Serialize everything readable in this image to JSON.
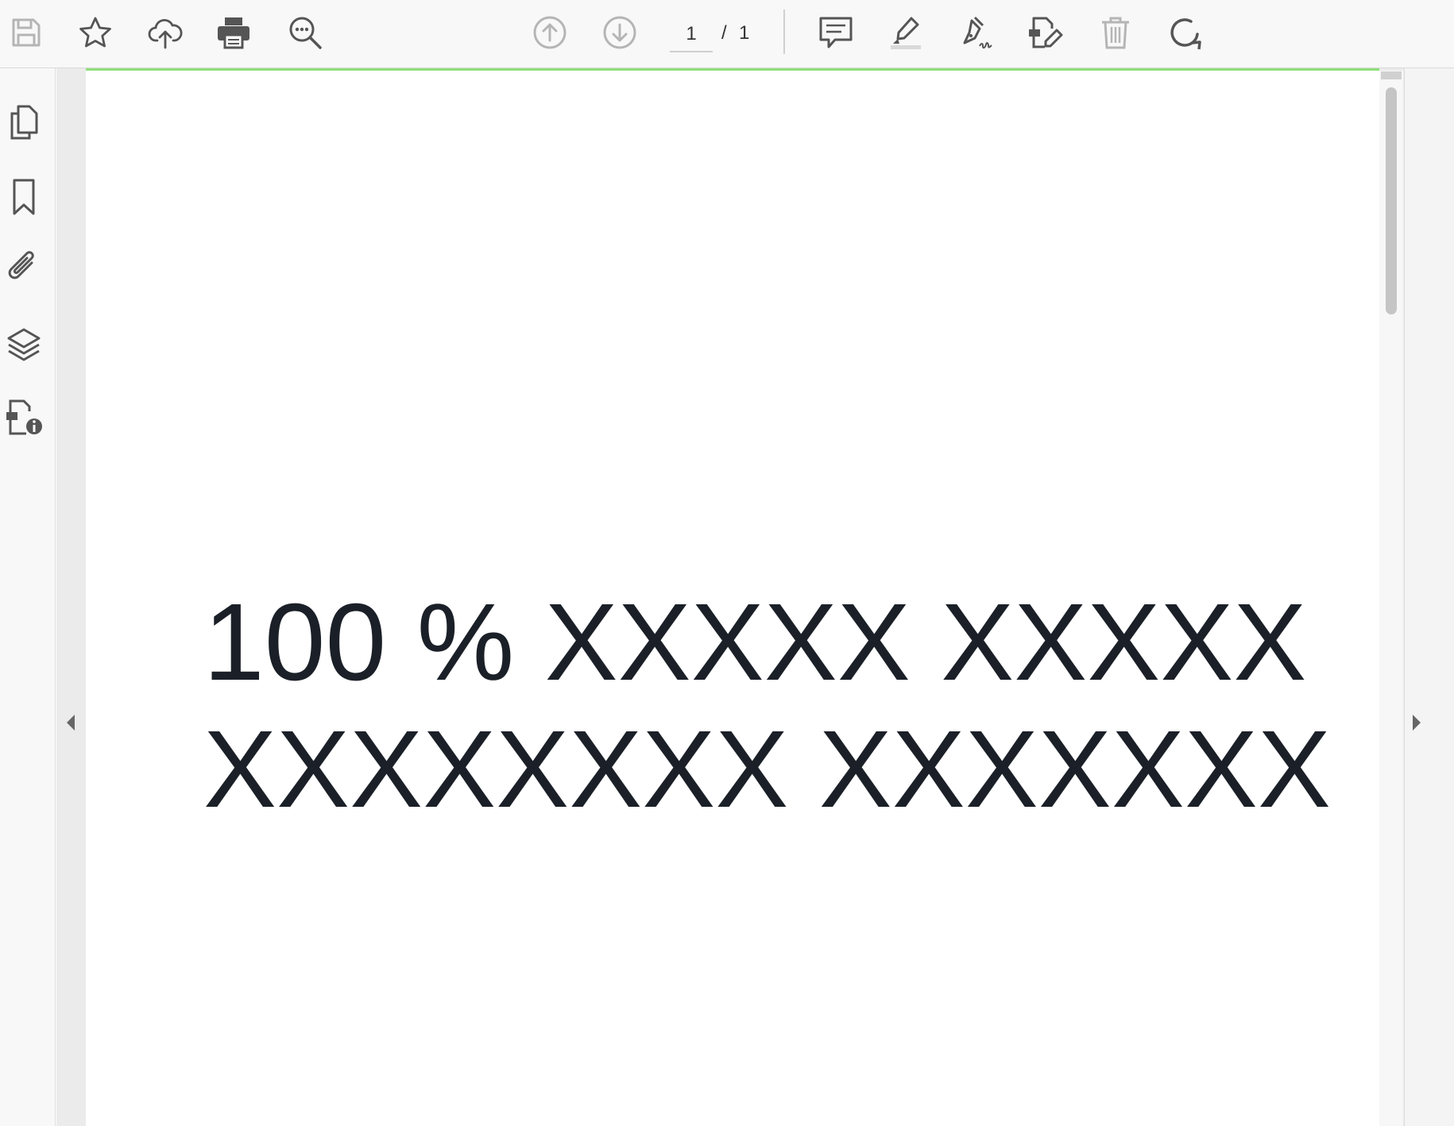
{
  "toolbar": {
    "icons": [
      "save-icon",
      "star-icon",
      "cloud-upload-icon",
      "print-icon",
      "search-more-icon",
      "arrow-up-circle-icon",
      "arrow-down-circle-icon",
      "comment-icon",
      "highlighter-icon",
      "pen-sign-icon",
      "edit-document-icon",
      "trash-icon",
      "rotate-icon"
    ],
    "page_current": "1",
    "page_separator": "/",
    "page_total": "1"
  },
  "sidebar": {
    "icons": [
      "pages-icon",
      "bookmark-icon",
      "attachment-icon",
      "layers-icon",
      "document-info-icon"
    ]
  },
  "document": {
    "lines": [
      "100 % XXXXX XXXXX",
      "XXXXXXXX XXXXXXX"
    ]
  },
  "colors": {
    "icon": "#555555",
    "icon_disabled": "#aaaaaa",
    "progress": "#8fe07a",
    "text": "#1b2028"
  }
}
